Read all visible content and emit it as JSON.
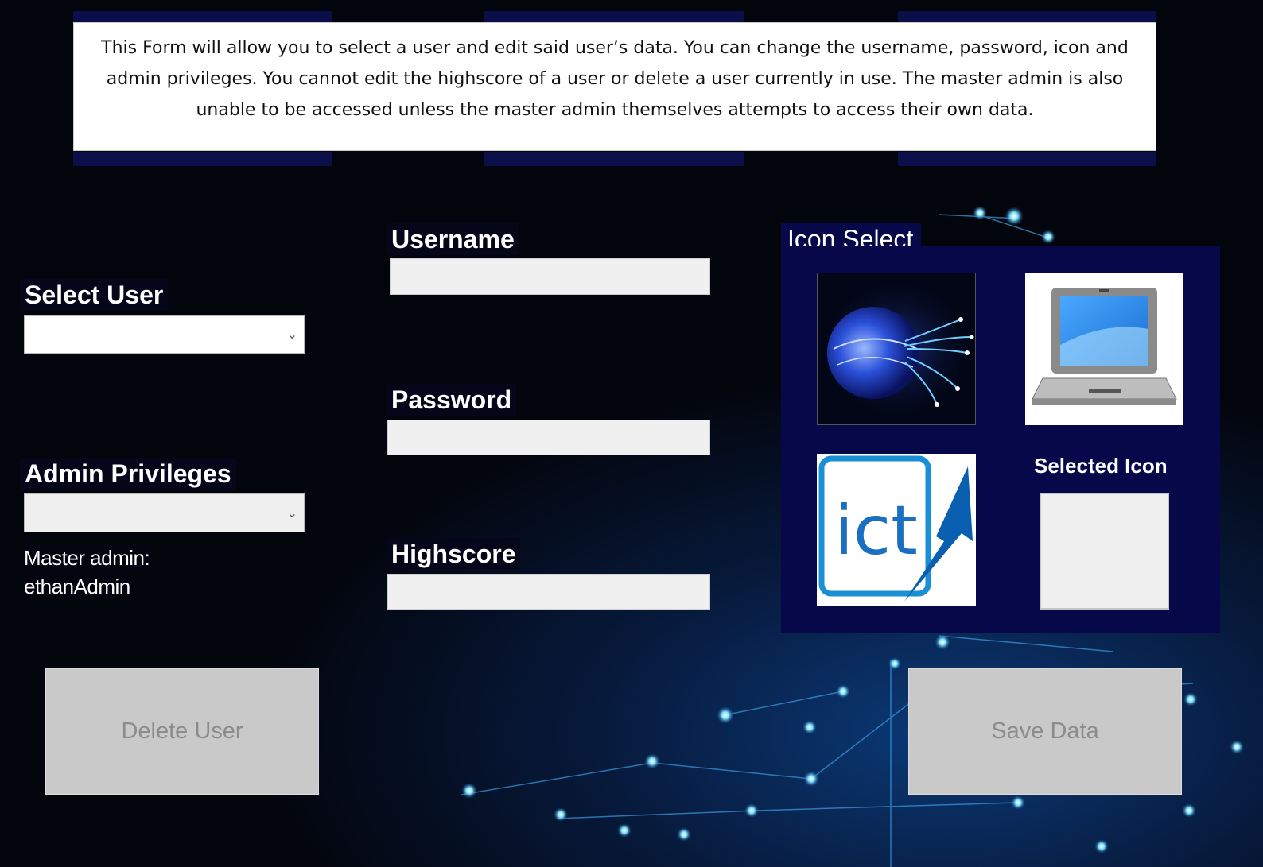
{
  "description_text": "This Form will allow you to select a user and edit said user’s data. You can change the username, password, icon and admin privileges. You cannot edit the highscore of a user or delete a user currently in use. The master admin is also unable to be accessed unless the master admin themselves attempts to access their own data.",
  "select_user": {
    "label": "Select User",
    "value": ""
  },
  "admin_privileges": {
    "label": "Admin Privileges",
    "value": ""
  },
  "master_admin": {
    "line1": "Master admin:",
    "line2": "ethanAdmin"
  },
  "username": {
    "label": "Username",
    "value": ""
  },
  "password": {
    "label": "Password",
    "value": ""
  },
  "highscore": {
    "label": "Highscore",
    "value": ""
  },
  "icon_select": {
    "label": "Icon Select",
    "icons": [
      "globe-fiber-icon",
      "laptop-icon",
      "ict-logo-icon"
    ],
    "ict_logo_text": "ict",
    "selected_label": "Selected Icon"
  },
  "buttons": {
    "delete": "Delete User",
    "save": "Save Data"
  },
  "colors": {
    "panel": "#06084a",
    "button_disabled": "#c9c9c9",
    "field": "#f0f0f0"
  }
}
